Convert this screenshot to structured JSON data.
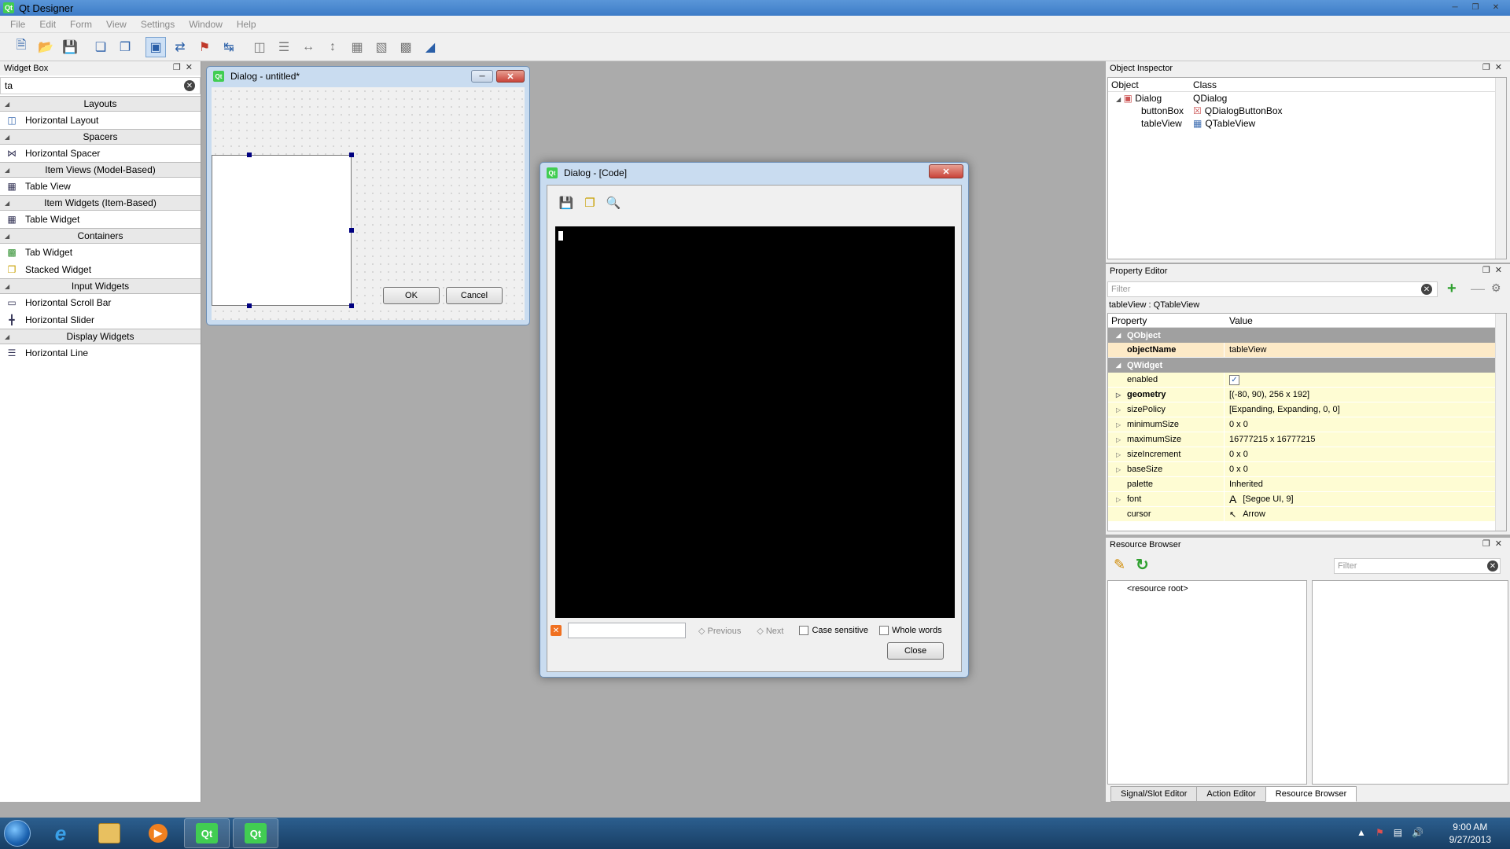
{
  "app": {
    "title": "Qt Designer"
  },
  "menu": [
    "File",
    "Edit",
    "Form",
    "View",
    "Settings",
    "Window",
    "Help"
  ],
  "widget_box": {
    "title": "Widget Box",
    "filter": "ta",
    "sections": [
      {
        "label": "Layouts",
        "items": [
          "Horizontal Layout"
        ]
      },
      {
        "label": "Spacers",
        "items": [
          "Horizontal Spacer"
        ]
      },
      {
        "label": "Item Views (Model-Based)",
        "items": [
          "Table View"
        ]
      },
      {
        "label": "Item Widgets (Item-Based)",
        "items": [
          "Table Widget"
        ]
      },
      {
        "label": "Containers",
        "items": [
          "Tab Widget",
          "Stacked Widget"
        ]
      },
      {
        "label": "Input Widgets",
        "items": [
          "Horizontal Scroll Bar",
          "Horizontal Slider"
        ]
      },
      {
        "label": "Display Widgets",
        "items": [
          "Horizontal Line"
        ]
      }
    ]
  },
  "form_window": {
    "title": "Dialog - untitled*",
    "ok": "OK",
    "cancel": "Cancel"
  },
  "code_dialog": {
    "title": "Dialog - [Code]",
    "previous": "Previous",
    "next": "Next",
    "case_sensitive": "Case sensitive",
    "whole_words": "Whole words",
    "close": "Close"
  },
  "object_inspector": {
    "title": "Object Inspector",
    "col_object": "Object",
    "col_class": "Class",
    "rows": [
      {
        "object": "Dialog",
        "class": "QDialog"
      },
      {
        "object": "buttonBox",
        "class": "QDialogButtonBox"
      },
      {
        "object": "tableView",
        "class": "QTableView"
      }
    ]
  },
  "property_editor": {
    "title": "Property Editor",
    "filter_placeholder": "Filter",
    "context": "tableView : QTableView",
    "col_property": "Property",
    "col_value": "Value",
    "group_qobject": "QObject",
    "objectName_label": "objectName",
    "objectName_value": "tableView",
    "group_qwidget": "QWidget",
    "props": [
      {
        "name": "enabled",
        "value": "✓"
      },
      {
        "name": "geometry",
        "value": "[(-80, 90), 256 x 192]"
      },
      {
        "name": "sizePolicy",
        "value": "[Expanding, Expanding, 0, 0]"
      },
      {
        "name": "minimumSize",
        "value": "0 x 0"
      },
      {
        "name": "maximumSize",
        "value": "16777215 x 16777215"
      },
      {
        "name": "sizeIncrement",
        "value": "0 x 0"
      },
      {
        "name": "baseSize",
        "value": "0 x 0"
      },
      {
        "name": "palette",
        "value": "Inherited"
      },
      {
        "name": "font",
        "value": "[Segoe UI, 9]"
      },
      {
        "name": "cursor",
        "value": "Arrow"
      }
    ]
  },
  "resource_browser": {
    "title": "Resource Browser",
    "filter_placeholder": "Filter",
    "root": "<resource root>",
    "tabs": [
      "Signal/Slot Editor",
      "Action Editor",
      "Resource Browser"
    ]
  },
  "taskbar": {
    "time": "9:00 AM",
    "date": "9/27/2013"
  }
}
